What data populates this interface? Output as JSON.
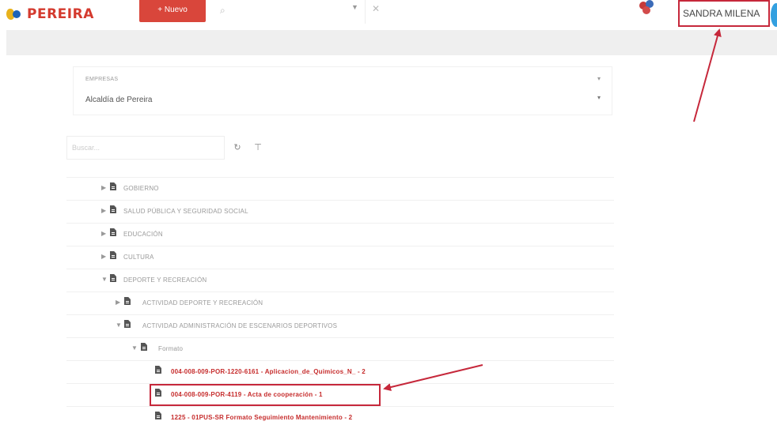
{
  "header": {
    "logo_text": "PEREIRA",
    "new_button": "+ Nuevo",
    "search_icon": "search-icon",
    "user_name": "SANDRA MILENA"
  },
  "company": {
    "label": "EMPRESAS",
    "value": "Alcaldía de Pereira"
  },
  "tree_search": {
    "placeholder": "Buscar..."
  },
  "tree": {
    "nodes": [
      {
        "label": "GOBIERNO",
        "toggle": "▶"
      },
      {
        "label": "SALUD PÚBLICA Y SEGURIDAD SOCIAL",
        "toggle": "▶"
      },
      {
        "label": "EDUCACIÓN",
        "toggle": "▶"
      },
      {
        "label": "CULTURA",
        "toggle": "▶"
      },
      {
        "label": "DEPORTE Y RECREACIÓN",
        "toggle": "▼"
      },
      {
        "label": "ACTIVIDAD DEPORTE Y RECREACIÓN",
        "toggle": "▶"
      },
      {
        "label": "ACTIVIDAD ADMINISTRACIÓN DE ESCENARIOS DEPORTIVOS",
        "toggle": "▼"
      },
      {
        "label": "Formato",
        "toggle": "▼"
      },
      {
        "label": "004-008-009-POR-1220-6161 - Aplicacion_de_Quimicos_N_ - 2"
      },
      {
        "label": "004-008-009-POR-4119 - Acta de cooperación - 1"
      },
      {
        "label": "1225 - 01PUS-SR Formato Seguimiento Mantenimiento - 2"
      }
    ]
  },
  "colors": {
    "brand_red": "#d43a2e",
    "annotation_red": "#c6283b",
    "doc_red": "#c62c2c"
  }
}
